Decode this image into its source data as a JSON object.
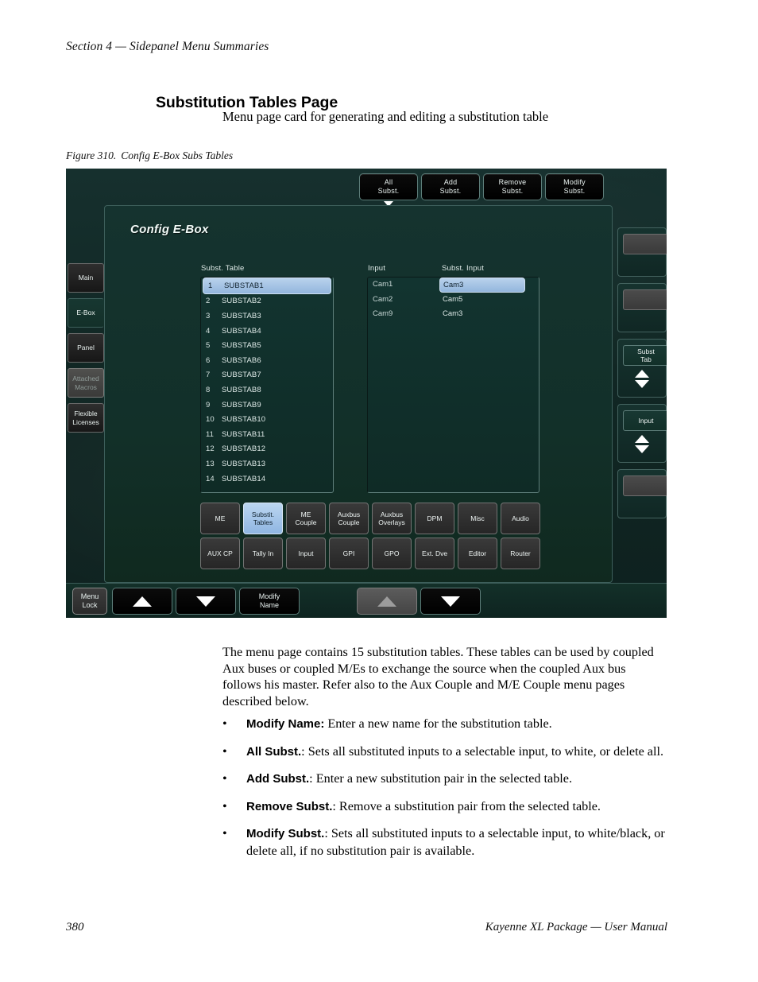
{
  "page": {
    "running_head": "Section 4 — Sidepanel Menu Summaries",
    "title": "Substitution Tables Page",
    "subtitle": "Menu page card for generating and editing a substitution table",
    "figure_number": "Figure 310.",
    "figure_caption": "Config E-Box Subs Tables",
    "footer_page_number": "380",
    "footer_text": "Kayenne XL Package  —  User Manual"
  },
  "screenshot": {
    "card_title": "Config E-Box",
    "top_buttons": [
      {
        "line1": "All",
        "line2": "Subst.",
        "has_dropdown_triangle": true
      },
      {
        "line1": "Add",
        "line2": "Subst.",
        "has_dropdown_triangle": false
      },
      {
        "line1": "Remove",
        "line2": "Subst.",
        "has_dropdown_triangle": false
      },
      {
        "line1": "Modify",
        "line2": "Subst.",
        "has_dropdown_triangle": false
      }
    ],
    "left_tabs": [
      {
        "line1": "Main",
        "line2": "",
        "state": "normal"
      },
      {
        "line1": "E-Box",
        "line2": "",
        "state": "active"
      },
      {
        "line1": "Panel",
        "line2": "",
        "state": "normal"
      },
      {
        "line1": "Attached",
        "line2": "Macros",
        "state": "disabled"
      },
      {
        "line1": "Flexible",
        "line2": "Licenses",
        "state": "normal"
      }
    ],
    "columns": {
      "subst_table": "Subst. Table",
      "input": "Input",
      "subst_input": "Subst. Input"
    },
    "subst_tables": [
      {
        "index": "1",
        "name": "SUBSTAB1",
        "selected": true
      },
      {
        "index": "2",
        "name": "SUBSTAB2",
        "selected": false
      },
      {
        "index": "3",
        "name": "SUBSTAB3",
        "selected": false
      },
      {
        "index": "4",
        "name": "SUBSTAB4",
        "selected": false
      },
      {
        "index": "5",
        "name": "SUBSTAB5",
        "selected": false
      },
      {
        "index": "6",
        "name": "SUBSTAB6",
        "selected": false
      },
      {
        "index": "7",
        "name": "SUBSTAB7",
        "selected": false
      },
      {
        "index": "8",
        "name": "SUBSTAB8",
        "selected": false
      },
      {
        "index": "9",
        "name": "SUBSTAB9",
        "selected": false
      },
      {
        "index": "10",
        "name": "SUBSTAB10",
        "selected": false
      },
      {
        "index": "11",
        "name": "SUBSTAB11",
        "selected": false
      },
      {
        "index": "12",
        "name": "SUBSTAB12",
        "selected": false
      },
      {
        "index": "13",
        "name": "SUBSTAB13",
        "selected": false
      },
      {
        "index": "14",
        "name": "SUBSTAB14",
        "selected": false
      }
    ],
    "input_pairs": [
      {
        "input": "Cam1",
        "subst_input": "Cam3",
        "selected": true
      },
      {
        "input": "Cam2",
        "subst_input": "Cam5",
        "selected": false
      },
      {
        "input": "Cam9",
        "subst_input": "Cam3",
        "selected": false
      }
    ],
    "category_row1": [
      {
        "line1": "ME",
        "line2": "",
        "active": false
      },
      {
        "line1": "Substit.",
        "line2": "Tables",
        "active": true
      },
      {
        "line1": "ME",
        "line2": "Couple",
        "active": false
      },
      {
        "line1": "Auxbus",
        "line2": "Couple",
        "active": false
      },
      {
        "line1": "Auxbus",
        "line2": "Overlays",
        "active": false
      },
      {
        "line1": "DPM",
        "line2": "",
        "active": false
      },
      {
        "line1": "Misc",
        "line2": "",
        "active": false
      },
      {
        "line1": "Audio",
        "line2": "",
        "active": false
      }
    ],
    "category_row2": [
      {
        "line1": "AUX CP",
        "line2": "",
        "active": false
      },
      {
        "line1": "Tally In",
        "line2": "",
        "active": false
      },
      {
        "line1": "Input",
        "line2": "",
        "active": false
      },
      {
        "line1": "GPI",
        "line2": "",
        "active": false
      },
      {
        "line1": "GPO",
        "line2": "",
        "active": false
      },
      {
        "line1": "Ext. Dve",
        "line2": "",
        "active": false
      },
      {
        "line1": "Editor",
        "line2": "",
        "active": false
      },
      {
        "line1": "Router",
        "line2": "",
        "active": false
      }
    ],
    "right_knobs": [
      {
        "line1": "",
        "line2": "",
        "has_chevrons": false
      },
      {
        "line1": "",
        "line2": "",
        "has_chevrons": false
      },
      {
        "line1": "Subst",
        "line2": "Tab",
        "has_chevrons": true
      },
      {
        "line1": "Input",
        "line2": "",
        "has_chevrons": true
      },
      {
        "line1": "",
        "line2": "",
        "has_chevrons": false
      }
    ],
    "bottom_bar": {
      "menu_lock_l1": "Menu",
      "menu_lock_l2": "Lock",
      "modify_name_l1": "Modify",
      "modify_name_l2": "Name"
    },
    "colors": {
      "panel_teal": "#123029",
      "selection_blue": "#93b6dd",
      "button_black": "#000000",
      "button_gray": "#3a3a3a",
      "text_light": "#dfeae8"
    }
  },
  "body": {
    "paragraph": "The menu page contains 15 substitution tables. These tables can be used by coupled Aux buses or coupled M/Es to exchange the source when the coupled Aux bus follows his master. Refer also to the Aux Couple and M/E Couple menu pages described below.",
    "bullets": [
      {
        "term": "Modify Name:",
        "text": " Enter a new name for the substitution table."
      },
      {
        "term": "All Subst.",
        "text": ": Sets all substituted inputs to a selectable input, to white, or delete all."
      },
      {
        "term": "Add Subst.",
        "text": ": Enter a new substitution pair in the selected table."
      },
      {
        "term": "Remove Subst.",
        "text": ": Remove a substitution pair from the selected table."
      },
      {
        "term": "Modify Subst.",
        "text": ": Sets all substituted inputs to a selectable input, to white/black, or delete all, if no substitution pair is available."
      }
    ]
  }
}
